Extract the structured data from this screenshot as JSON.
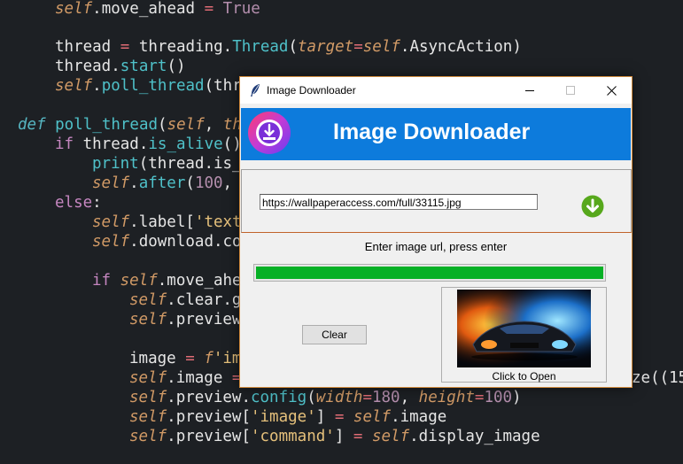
{
  "editor": {
    "line1": {
      "self": "self",
      "attr": ".move_ahead ",
      "op": "=",
      "value": " True"
    },
    "line2": {
      "text": "thread ",
      "op": "=",
      "mid": " threading.",
      "cls": "Thread",
      "paren": "(",
      "kwarg": "target",
      "op2": "=",
      "self": "self",
      "tail": ".AsyncAction)"
    },
    "line3": {
      "text": "thread.",
      "fn": "start",
      "tail": "()"
    },
    "line4": {
      "self": "self",
      "attr": ".",
      "fn": "poll_thread",
      "tail": "(thr"
    },
    "line5": {
      "kw": "def",
      "fn": " poll_thread",
      "paren": "(",
      "self": "self",
      "comma": ", ",
      "arg": "th"
    },
    "line6": {
      "kw": "if",
      "text": " thread.",
      "fn": "is_alive",
      "tail": "()"
    },
    "line7": {
      "fn": "print",
      "tail": "(thread.is_"
    },
    "line8": {
      "self": "self",
      "attr": ".",
      "fn": "after",
      "paren": "(",
      "num": "100",
      "tail": ","
    },
    "line9": {
      "kw": "else",
      "tail": ":"
    },
    "line10": {
      "self": "self",
      "attr": ".label[",
      "str": "'text"
    },
    "line11": {
      "self": "self",
      "attr": ".download.co"
    },
    "line12": {
      "kw": "if",
      "self": " self",
      "attr": ".move_ahe"
    },
    "line13": {
      "self": "self",
      "attr": ".clear.g"
    },
    "line14": {
      "self": "self",
      "attr": ".preview"
    },
    "line15": {
      "text": "image ",
      "op": "=",
      "fprefix": " f",
      "str": "'im"
    },
    "line16": {
      "self": "self",
      "attr": ".image ",
      "op": "=",
      "tail": "ze((15"
    },
    "line17": {
      "self": "self",
      "attr": ".preview.",
      "fn": "config",
      "paren": "(",
      "k1": "width",
      "op1": "=",
      "n1": "180",
      "comma": ", ",
      "k2": "height",
      "op2": "=",
      "n2": "100",
      "close": ")"
    },
    "line18": {
      "self": "self",
      "attr": ".preview[",
      "str": "'image'",
      "close": "] ",
      "op": "=",
      "self2": " self",
      "tail": ".image"
    },
    "line19": {
      "self": "self",
      "attr": ".preview[",
      "str": "'command'",
      "close": "] ",
      "op": "=",
      "self2": " self",
      "tail": ".display_image"
    }
  },
  "window": {
    "title": "Image Downloader",
    "controls": {
      "minimize": "—",
      "maximize": "☐",
      "close": "✕"
    },
    "header_title": "Image Downloader",
    "url_value": "https://wallpaperaccess.com/full/33115.jpg",
    "prompt": "Enter image url, press enter",
    "progress_percent": 100,
    "clear_label": "Clear",
    "preview_label": "Click to Open"
  },
  "colors": {
    "header": "#0d7bdc",
    "progress": "#06b025",
    "download_button": "#57a81c"
  },
  "icons": [
    "feather-icon",
    "download-logo-icon",
    "download-arrow-icon"
  ]
}
